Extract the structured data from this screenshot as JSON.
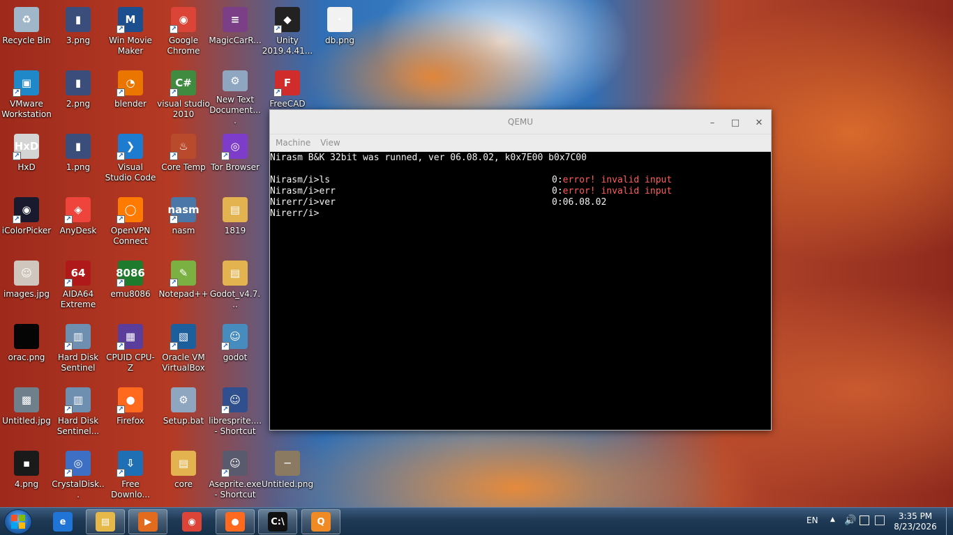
{
  "desktop": {
    "icons": [
      {
        "label": "Recycle Bin",
        "color": "#9fb7c8",
        "glyph": "♻",
        "shortcut": false
      },
      {
        "label": "3.png",
        "color": "#3b4d7a",
        "glyph": "▮",
        "shortcut": false
      },
      {
        "label": "Win Movie Maker",
        "color": "#1b4f8f",
        "glyph": "M",
        "shortcut": true
      },
      {
        "label": "Google Chrome",
        "color": "#db4437",
        "glyph": "◉",
        "shortcut": true
      },
      {
        "label": "MagicCarR...",
        "color": "#7a3f86",
        "glyph": "≡",
        "shortcut": false
      },
      {
        "label": "Unity 2019.4.41...",
        "color": "#222222",
        "glyph": "◆",
        "shortcut": true
      },
      {
        "label": "db.png",
        "color": "#f2f2f2",
        "glyph": "·",
        "shortcut": false
      },
      {
        "label": "VMware Workstation",
        "color": "#1e88c8",
        "glyph": "▣",
        "shortcut": true
      },
      {
        "label": "2.png",
        "color": "#3b4d7a",
        "glyph": "▮",
        "shortcut": false
      },
      {
        "label": "blender",
        "color": "#ea7600",
        "glyph": "◔",
        "shortcut": true
      },
      {
        "label": "visual studio 2010",
        "color": "#3f8b3f",
        "glyph": "C#",
        "shortcut": true
      },
      {
        "label": "New Text Document....",
        "color": "#8fa6c1",
        "glyph": "⚙",
        "shortcut": false
      },
      {
        "label": "FreeCAD",
        "color": "#d02c2c",
        "glyph": "F",
        "shortcut": true
      },
      {
        "label": "HxD",
        "color": "#d4d4d4",
        "glyph": "HxD",
        "shortcut": true
      },
      {
        "label": "1.png",
        "color": "#3b4d7a",
        "glyph": "▮",
        "shortcut": false
      },
      {
        "label": "Visual Studio Code",
        "color": "#1d7bd0",
        "glyph": "❯",
        "shortcut": true
      },
      {
        "label": "Core Temp",
        "color": "#b94a2c",
        "glyph": "♨",
        "shortcut": true
      },
      {
        "label": "Tor Browser",
        "color": "#7d3cc9",
        "glyph": "◎",
        "shortcut": true
      },
      {
        "label": "iColorPicker",
        "color": "#1a1a2e",
        "glyph": "◉",
        "shortcut": true
      },
      {
        "label": "AnyDesk",
        "color": "#ef443b",
        "glyph": "◈",
        "shortcut": true
      },
      {
        "label": "OpenVPN Connect",
        "color": "#ff7a00",
        "glyph": "◯",
        "shortcut": true
      },
      {
        "label": "nasm",
        "color": "#4a76a8",
        "glyph": "nasm",
        "shortcut": true
      },
      {
        "label": "1819",
        "color": "#e2b34f",
        "glyph": "▤",
        "shortcut": false
      },
      {
        "label": "images.jpg",
        "color": "#cfc7bd",
        "glyph": "☺",
        "shortcut": false
      },
      {
        "label": "AIDA64 Extreme",
        "color": "#b01919",
        "glyph": "64",
        "shortcut": true
      },
      {
        "label": "emu8086",
        "color": "#1e7a2c",
        "glyph": "8086",
        "shortcut": true
      },
      {
        "label": "Notepad++",
        "color": "#7bb042",
        "glyph": "✎",
        "shortcut": true
      },
      {
        "label": "Godot_v4.7...",
        "color": "#e2b34f",
        "glyph": "▤",
        "shortcut": false
      },
      {
        "label": "orac.png",
        "color": "#050505",
        "glyph": "",
        "shortcut": false
      },
      {
        "label": "Hard Disk Sentinel",
        "color": "#6f8fb0",
        "glyph": "▥",
        "shortcut": true
      },
      {
        "label": "CPUID CPU-Z",
        "color": "#5b3d9c",
        "glyph": "▦",
        "shortcut": true
      },
      {
        "label": "Oracle VM VirtualBox",
        "color": "#1d5e9c",
        "glyph": "▧",
        "shortcut": true
      },
      {
        "label": "godot",
        "color": "#478cbf",
        "glyph": "☺",
        "shortcut": true
      },
      {
        "label": "Untitled.jpg",
        "color": "#6f7f8c",
        "glyph": "▩",
        "shortcut": false
      },
      {
        "label": "Hard Disk Sentinel...",
        "color": "#6f8fb0",
        "glyph": "▥",
        "shortcut": true
      },
      {
        "label": "Firefox",
        "color": "#ff6a1f",
        "glyph": "●",
        "shortcut": true
      },
      {
        "label": "Setup.bat",
        "color": "#8fa6c1",
        "glyph": "⚙",
        "shortcut": false
      },
      {
        "label": "libresprite.... - Shortcut",
        "color": "#2f4f8f",
        "glyph": "☺",
        "shortcut": true
      },
      {
        "label": "4.png",
        "color": "#1a1a1a",
        "glyph": "▪",
        "shortcut": false
      },
      {
        "label": "CrystalDisk...",
        "color": "#3d6fc4",
        "glyph": "◎",
        "shortcut": true
      },
      {
        "label": "Free Downlo...",
        "color": "#1f6fb5",
        "glyph": "⇩",
        "shortcut": true
      },
      {
        "label": "core",
        "color": "#e2b34f",
        "glyph": "▤",
        "shortcut": false
      },
      {
        "label": "Aseprite.exe - Shortcut",
        "color": "#5a5a6e",
        "glyph": "☺",
        "shortcut": true
      },
      {
        "label": "Untitled.png",
        "color": "#8a7a62",
        "glyph": "─",
        "shortcut": false
      }
    ]
  },
  "qemu": {
    "title": "QEMU",
    "menu": [
      "Machine",
      "View"
    ],
    "buttons": {
      "minimize": "–",
      "maximize": "□",
      "close": "✕"
    },
    "console": {
      "banner": "Nirasm B&K 32bit was runned, ver 06.08.02, k0x7E00 b0x7C00",
      "lines": [
        {
          "prompt": "Nirasm/i>ls",
          "code": "0:",
          "result": "error! invalid input",
          "is_error": true
        },
        {
          "prompt": "Nirasm/i>err",
          "code": "0:",
          "result": "error! invalid input",
          "is_error": true
        },
        {
          "prompt": "Nirerr/i>ver",
          "code": "0:",
          "result": "06.08.02",
          "is_error": false
        },
        {
          "prompt": "Nirerr/i>",
          "code": "",
          "result": "",
          "is_error": false
        }
      ]
    }
  },
  "taskbar": {
    "apps": [
      {
        "name": "internet-explorer",
        "color": "#1f74d6",
        "glyph": "e",
        "active": false
      },
      {
        "name": "file-explorer",
        "color": "#e6b84a",
        "glyph": "▤",
        "active": true
      },
      {
        "name": "media-player",
        "color": "#e36b1d",
        "glyph": "▶",
        "active": true
      },
      {
        "name": "google-chrome",
        "color": "#db4437",
        "glyph": "◉",
        "active": false
      },
      {
        "name": "firefox",
        "color": "#ff6a1f",
        "glyph": "●",
        "active": true
      },
      {
        "name": "command-prompt",
        "color": "#111111",
        "glyph": "C:\\",
        "active": true
      },
      {
        "name": "qemu",
        "color": "#f08a24",
        "glyph": "Q",
        "active": true
      }
    ],
    "tray": {
      "language": "EN",
      "time": "3:35 PM",
      "date": "8/23/2026"
    }
  }
}
